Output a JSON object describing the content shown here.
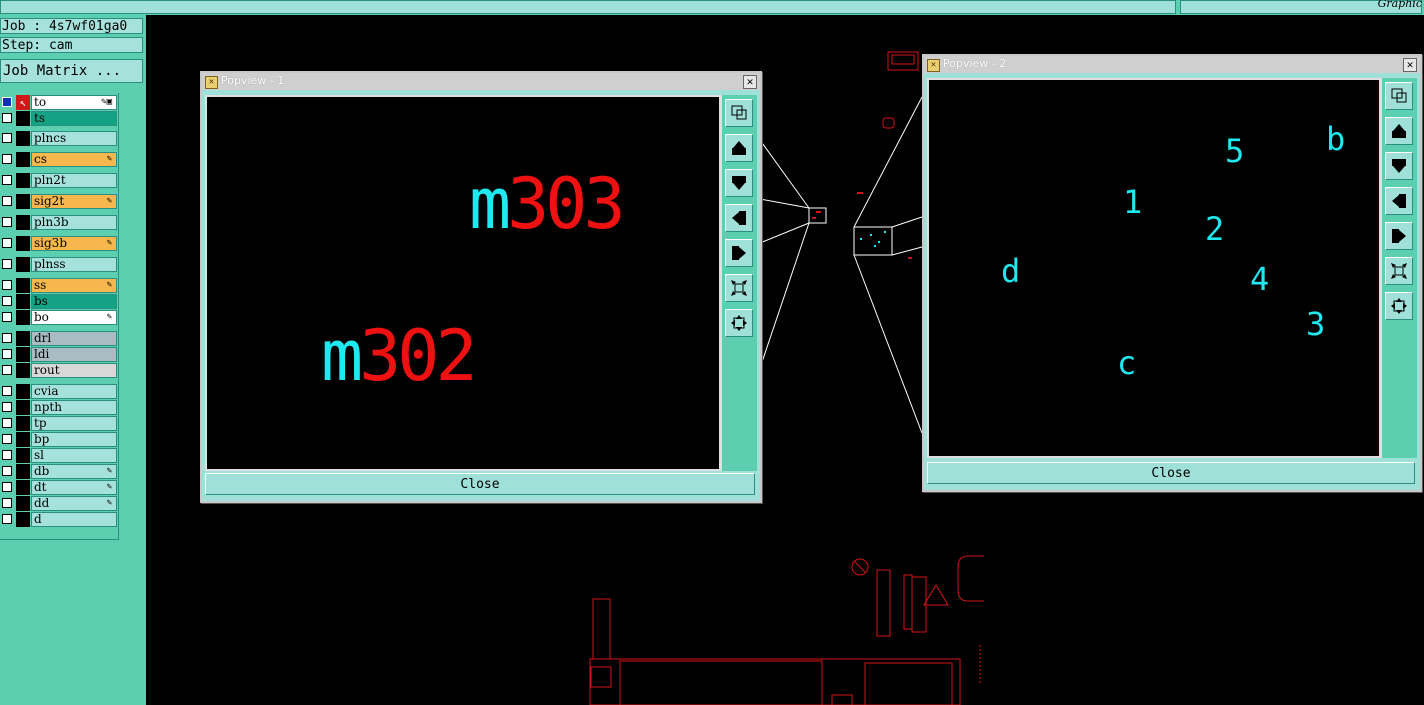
{
  "header": {
    "graphic_label": "Graphic"
  },
  "info": {
    "job": "Job : 4s7wf01ga0",
    "step": "Step: cam",
    "job_matrix": "Job Matrix ..."
  },
  "layers": [
    {
      "name": "to",
      "color": "#ffffff",
      "flag": "✎▣",
      "active": true
    },
    {
      "name": "ts",
      "color": "#13a283",
      "flag": ""
    },
    {
      "name": "plncs",
      "color": "#a6e2dc",
      "flag": ""
    },
    {
      "name": "cs",
      "color": "#f6b84c",
      "flag": "✎"
    },
    {
      "name": "pln2t",
      "color": "#a6e2dc",
      "flag": ""
    },
    {
      "name": "sig2t",
      "color": "#f6b84c",
      "flag": "✎"
    },
    {
      "name": "pln3b",
      "color": "#a6e2dc",
      "flag": ""
    },
    {
      "name": "sig3b",
      "color": "#f6b84c",
      "flag": "✎"
    },
    {
      "name": "plnss",
      "color": "#a6e2dc",
      "flag": ""
    },
    {
      "name": "ss",
      "color": "#f6b84c",
      "flag": "✎"
    },
    {
      "name": "bs",
      "color": "#13a283",
      "flag": ""
    },
    {
      "name": "bo",
      "color": "#ffffff",
      "flag": "✎"
    },
    {
      "name": "drl",
      "color": "#a9bcc4",
      "flag": ""
    },
    {
      "name": "ldi",
      "color": "#a9bcc4",
      "flag": ""
    },
    {
      "name": "rout",
      "color": "#d8d8d8",
      "flag": ""
    },
    {
      "name": "cvia",
      "color": "#a6e2dc",
      "flag": ""
    },
    {
      "name": "npth",
      "color": "#a6e2dc",
      "flag": ""
    },
    {
      "name": "tp",
      "color": "#a6e2dc",
      "flag": ""
    },
    {
      "name": "bp",
      "color": "#a6e2dc",
      "flag": ""
    },
    {
      "name": "sl",
      "color": "#a6e2dc",
      "flag": ""
    },
    {
      "name": "db",
      "color": "#a6e2dc",
      "flag": "✎"
    },
    {
      "name": "dt",
      "color": "#a6e2dc",
      "flag": "✎"
    },
    {
      "name": "dd",
      "color": "#a6e2dc",
      "flag": "✎"
    },
    {
      "name": "d",
      "color": "#a6e2dc",
      "flag": ""
    }
  ],
  "popview1": {
    "title": "Popview - 1",
    "close_label": "Close",
    "labels": [
      {
        "prefix": "m",
        "number": "303"
      },
      {
        "prefix": "m",
        "number": "302"
      }
    ]
  },
  "popview2": {
    "title": "Popview - 2",
    "close_label": "Close",
    "markers": [
      "5",
      "b",
      "1",
      "2",
      "d",
      "4",
      "3",
      "c"
    ]
  },
  "colors": {
    "accent_teal": "#5ccfb0",
    "cyan_text": "#1ee8f0",
    "red_text": "#ee1111",
    "board_red": "#d41414"
  },
  "tool_icons": [
    "zoom-window-icon",
    "pan-up-icon",
    "pan-down-icon",
    "pan-left-icon",
    "pan-right-icon",
    "zoom-out-icon",
    "zoom-in-icon"
  ]
}
